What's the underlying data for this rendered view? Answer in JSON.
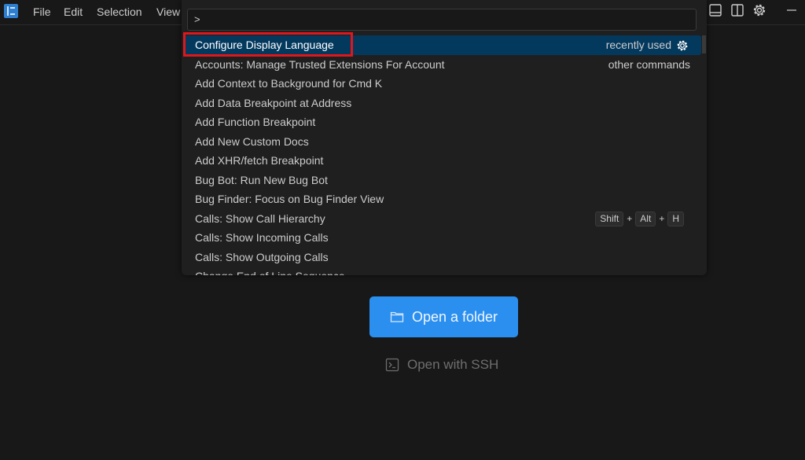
{
  "menubar": {
    "items": [
      "File",
      "Edit",
      "Selection",
      "View"
    ]
  },
  "palette": {
    "input_value": ">",
    "items": [
      {
        "label": "Configure Display Language",
        "right": "recently used"
      },
      {
        "label": "Accounts: Manage Trusted Extensions For Account",
        "right": "other commands"
      },
      {
        "label": "Add Context to Background for Cmd K"
      },
      {
        "label": "Add Data Breakpoint at Address"
      },
      {
        "label": "Add Function Breakpoint"
      },
      {
        "label": "Add New Custom Docs"
      },
      {
        "label": "Add XHR/fetch Breakpoint"
      },
      {
        "label": "Bug Bot: Run New Bug Bot"
      },
      {
        "label": "Bug Finder: Focus on Bug Finder View"
      },
      {
        "label": "Calls: Show Call Hierarchy",
        "keys": [
          "Shift",
          "Alt",
          "H"
        ]
      },
      {
        "label": "Calls: Show Incoming Calls"
      },
      {
        "label": "Calls: Show Outgoing Calls"
      },
      {
        "label": "Change End of Line Sequence"
      }
    ]
  },
  "welcome": {
    "open_folder": "Open a folder",
    "open_ssh": "Open with SSH"
  },
  "colors": {
    "accent": "#2b8ff0",
    "selection": "#04395e",
    "highlight_box": "#e0161b"
  }
}
